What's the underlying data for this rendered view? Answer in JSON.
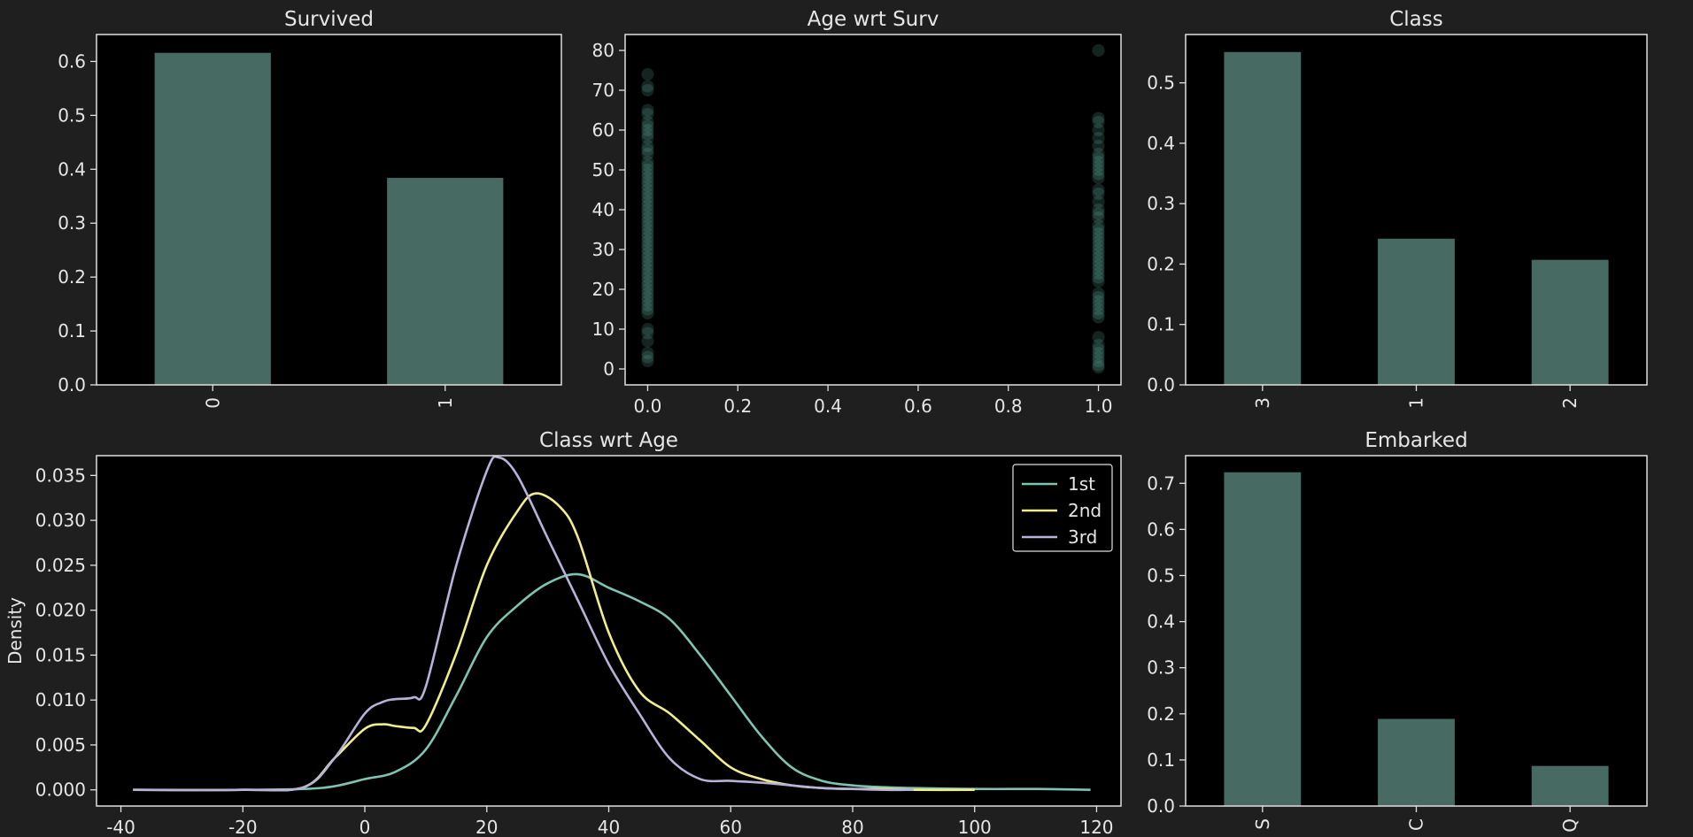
{
  "colors": {
    "figure_bg": "#1f1f1f",
    "axes_bg": "#000000",
    "axes_edge": "#e0e0e0",
    "text": "#e6e6e6",
    "bar_fill": "#476a63",
    "scatter_fill": "#5da898",
    "kde_1st": "#7fc3b3",
    "kde_2nd": "#f0ee8c",
    "kde_3rd": "#b9b2d8"
  },
  "chart_data": [
    {
      "id": "survived",
      "type": "bar",
      "title": "Survived",
      "categories": [
        "0",
        "1"
      ],
      "values": [
        0.616,
        0.384
      ],
      "ylim": [
        0,
        0.65
      ],
      "yticks": [
        0.0,
        0.1,
        0.2,
        0.3,
        0.4,
        0.5,
        0.6
      ],
      "xlabel": "",
      "ylabel": "",
      "xtick_rotation": -90,
      "grid": false
    },
    {
      "id": "age_wrt_surv",
      "type": "scatter",
      "title": "Age wrt Surv",
      "xlim": [
        -0.05,
        1.05
      ],
      "ylim": [
        -4,
        84
      ],
      "xticks": [
        0.0,
        0.2,
        0.4,
        0.6,
        0.8,
        1.0
      ],
      "yticks": [
        0,
        10,
        20,
        30,
        40,
        50,
        60,
        70,
        80
      ],
      "series": [
        {
          "x": 0,
          "y": [
            2,
            3,
            4,
            7,
            9,
            10,
            14,
            15,
            16,
            17,
            18,
            19,
            20,
            21,
            22,
            23,
            24,
            25,
            26,
            27,
            28,
            29,
            30,
            31,
            32,
            33,
            34,
            35,
            36,
            37,
            38,
            39,
            40,
            41,
            42,
            43,
            44,
            45,
            46,
            47,
            48,
            49,
            50,
            51,
            52,
            54,
            55,
            56,
            58,
            59,
            60,
            61,
            62,
            64,
            65,
            70,
            71,
            74
          ]
        },
        {
          "x": 1,
          "y": [
            0.4,
            1,
            2,
            3,
            4,
            5,
            6,
            8,
            13,
            14,
            15,
            16,
            17,
            18,
            19,
            22,
            23,
            24,
            25,
            26,
            27,
            28,
            29,
            30,
            31,
            32,
            33,
            34,
            35,
            36,
            38,
            39,
            40,
            42,
            44,
            45,
            48,
            49,
            50,
            51,
            52,
            53,
            54,
            56,
            58,
            60,
            62,
            63,
            80
          ]
        }
      ],
      "xlabel": "",
      "ylabel": "",
      "grid": false
    },
    {
      "id": "class",
      "type": "bar",
      "title": "Class",
      "categories": [
        "3",
        "1",
        "2"
      ],
      "values": [
        0.551,
        0.242,
        0.207
      ],
      "ylim": [
        0,
        0.58
      ],
      "yticks": [
        0.0,
        0.1,
        0.2,
        0.3,
        0.4,
        0.5
      ],
      "xlabel": "",
      "ylabel": "",
      "xtick_rotation": -90,
      "grid": false
    },
    {
      "id": "class_wrt_age",
      "type": "line",
      "title": "Class wrt Age",
      "xlabel": "",
      "ylabel": "Density",
      "xlim": [
        -44,
        124
      ],
      "ylim": [
        -0.0018,
        0.0372
      ],
      "xticks": [
        -40,
        -20,
        0,
        20,
        40,
        60,
        80,
        100,
        120
      ],
      "yticks": [
        0.0,
        0.005,
        0.01,
        0.015,
        0.02,
        0.025,
        0.03,
        0.035
      ],
      "ytick_labels": [
        "0.000",
        "0.005",
        "0.010",
        "0.015",
        "0.020",
        "0.025",
        "0.030",
        "0.035"
      ],
      "legend_position": "top-right",
      "series": [
        {
          "name": "1st",
          "color_key": "kde_1st",
          "x": [
            -38,
            -20,
            -10,
            -5,
            0,
            5,
            10,
            15,
            20,
            25,
            30,
            35,
            40,
            45,
            50,
            55,
            60,
            65,
            70,
            75,
            80,
            85,
            90,
            100,
            110,
            119
          ],
          "y": [
            0,
            0,
            0.0001,
            0.0004,
            0.0012,
            0.002,
            0.0045,
            0.0105,
            0.017,
            0.0205,
            0.023,
            0.024,
            0.0225,
            0.021,
            0.019,
            0.015,
            0.0105,
            0.006,
            0.0025,
            0.001,
            0.0005,
            0.0003,
            0.0002,
            0.0001,
            0.0001,
            0
          ]
        },
        {
          "name": "2nd",
          "color_key": "kde_2nd",
          "x": [
            -38,
            -20,
            -10,
            -5,
            0,
            3,
            5,
            8,
            10,
            15,
            20,
            25,
            28,
            32,
            35,
            40,
            45,
            50,
            55,
            60,
            65,
            70,
            75,
            80,
            85,
            90,
            100
          ],
          "y": [
            0,
            0,
            0.0003,
            0.0035,
            0.0068,
            0.0073,
            0.0071,
            0.0069,
            0.0072,
            0.0152,
            0.025,
            0.031,
            0.033,
            0.0315,
            0.028,
            0.0175,
            0.011,
            0.0085,
            0.0055,
            0.0025,
            0.0012,
            0.0005,
            0.0002,
            0.0001,
            0.0001,
            0,
            0
          ]
        },
        {
          "name": "3rd",
          "color_key": "kde_3rd",
          "x": [
            -38,
            -20,
            -10,
            -5,
            0,
            3,
            5,
            8,
            10,
            15,
            20,
            22,
            25,
            30,
            35,
            40,
            45,
            50,
            55,
            60,
            65,
            70,
            75,
            80,
            85,
            90
          ],
          "y": [
            0,
            0,
            0.0003,
            0.0035,
            0.0085,
            0.0098,
            0.0101,
            0.0103,
            0.0115,
            0.025,
            0.0355,
            0.037,
            0.035,
            0.028,
            0.021,
            0.014,
            0.0085,
            0.0035,
            0.0012,
            0.001,
            0.0008,
            0.0005,
            0.0002,
            0.0001,
            0,
            0
          ]
        }
      ],
      "grid": false
    },
    {
      "id": "embarked",
      "type": "bar",
      "title": "Embarked",
      "categories": [
        "S",
        "C",
        "Q"
      ],
      "values": [
        0.724,
        0.189,
        0.087
      ],
      "ylim": [
        0,
        0.76
      ],
      "yticks": [
        0.0,
        0.1,
        0.2,
        0.3,
        0.4,
        0.5,
        0.6,
        0.7
      ],
      "xlabel": "",
      "ylabel": "",
      "xtick_rotation": -90,
      "grid": false
    }
  ]
}
